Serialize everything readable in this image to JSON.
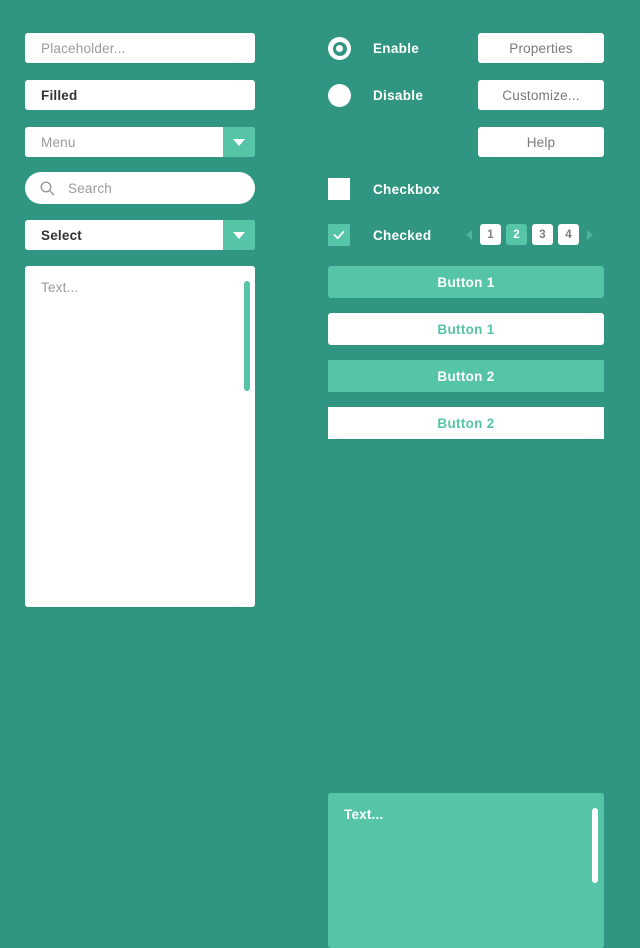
{
  "theme": {
    "background": "#319681",
    "accent": "#55c4a7",
    "surface": "#ffffff",
    "placeholder_text": "#9b9b9b",
    "value_text": "#333333",
    "button_text": "#7a7a7a",
    "label_text": "#ffffff"
  },
  "left_column": {
    "placeholder_input": {
      "placeholder": "Placeholder...",
      "value": ""
    },
    "filled_input": {
      "value": "Filled",
      "placeholder": ""
    },
    "menu_dropdown": {
      "value": "",
      "placeholder": "Menu",
      "arrow_icon": "caret-down-icon"
    },
    "search_input": {
      "placeholder": "Search",
      "value": "",
      "icon": "search-icon"
    },
    "select_dropdown": {
      "value": "Select",
      "placeholder": "",
      "arrow_icon": "caret-down-icon"
    },
    "textarea": {
      "placeholder": "Text...",
      "value": "",
      "has_scrollbar": true
    }
  },
  "right_column": {
    "radios": [
      {
        "label": "Enable",
        "selected": true
      },
      {
        "label": "Disable",
        "selected": false
      }
    ],
    "checkboxes": [
      {
        "label": "Checkbox",
        "checked": false
      },
      {
        "label": "Checked",
        "checked": true,
        "icon": "check-icon"
      }
    ],
    "side_buttons": [
      {
        "label": "Properties"
      },
      {
        "label": "Customize..."
      },
      {
        "label": "Help"
      }
    ],
    "pagination": {
      "prev_icon": "chevron-left-icon",
      "next_icon": "chevron-right-icon",
      "pages": [
        "1",
        "2",
        "3",
        "4"
      ],
      "active_page": "2"
    },
    "wide_buttons": [
      {
        "label": "Button 1",
        "style": "filled",
        "shape": "rounded"
      },
      {
        "label": "Button 1",
        "style": "outline",
        "shape": "rounded"
      },
      {
        "label": "Button 2",
        "style": "filled",
        "shape": "square"
      },
      {
        "label": "Button 2",
        "style": "outline",
        "shape": "square"
      }
    ],
    "textarea": {
      "placeholder": "Text...",
      "value": "",
      "has_scrollbar": true
    }
  }
}
